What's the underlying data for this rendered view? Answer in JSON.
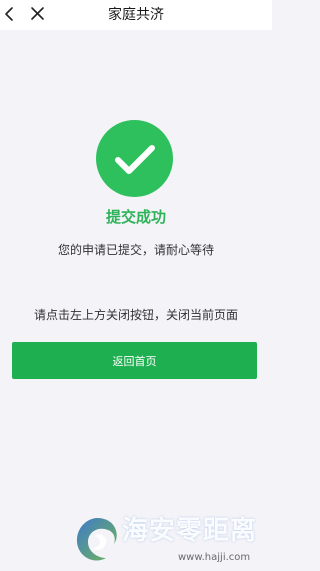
{
  "header": {
    "title": "家庭共济",
    "back_icon": "chevron-left-icon",
    "close_icon": "close-icon"
  },
  "result": {
    "icon": "check-icon",
    "status": "提交成功",
    "message": "您的申请已提交，请耐心等待",
    "hint": "请点击左上方关闭按钮，关闭当前页面"
  },
  "actions": {
    "return_home_label": "返回首页"
  },
  "watermark": {
    "name": "海安零距离",
    "url": "www.hajji.com"
  },
  "colors": {
    "accent_green": "#2fc05e",
    "button_green": "#1eaf50",
    "background": "#f3f3f8"
  }
}
